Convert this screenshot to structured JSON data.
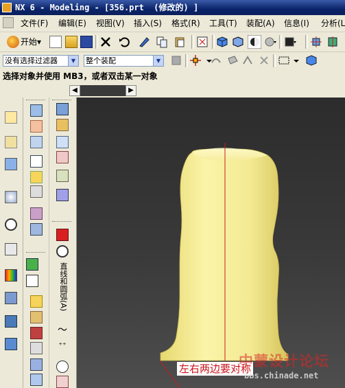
{
  "window": {
    "title": "NX 6 - Modeling - [356.prt  (修改的) ]"
  },
  "menu": {
    "items": [
      {
        "label": "文件(F)"
      },
      {
        "label": "编辑(E)"
      },
      {
        "label": "视图(V)"
      },
      {
        "label": "插入(S)"
      },
      {
        "label": "格式(R)"
      },
      {
        "label": "工具(T)"
      },
      {
        "label": "装配(A)"
      },
      {
        "label": "信息(I)"
      },
      {
        "label": "分析(L)"
      }
    ]
  },
  "toolbar": {
    "start_label": "开始▾"
  },
  "selection": {
    "filter_value": "没有选择过滤器",
    "scope_value": "整个装配"
  },
  "status": {
    "prompt": "选择对象并使用 MB3，或者双击某一对象"
  },
  "palette": {
    "vertical_label": "直线和圆弧(A)"
  },
  "annotation": {
    "text": "左右两边要对称"
  },
  "watermark": {
    "brand": "中蒙设计论坛",
    "url": "bbs.chinade.net"
  },
  "colors": {
    "model": "#f6ef9a",
    "axis_line": "#cc1a1a",
    "viewport_bg": "#3a3a3a"
  }
}
